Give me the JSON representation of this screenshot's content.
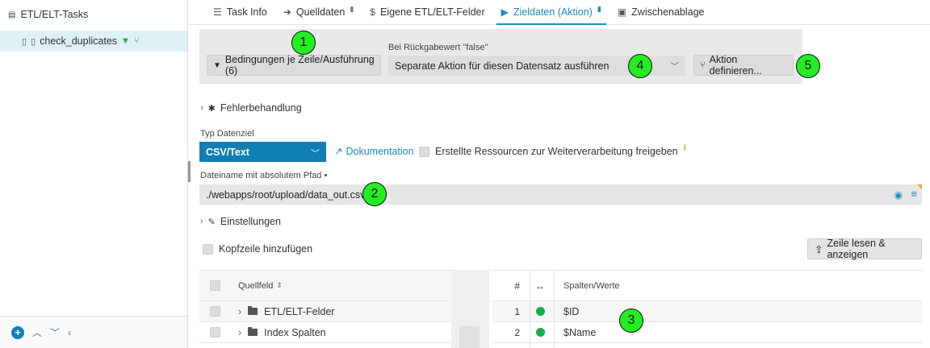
{
  "sidebar": {
    "title": "ETL/ELT-Tasks",
    "selected_item": "check_duplicates"
  },
  "tabs": [
    {
      "label": "Task Info",
      "icon": "list-icon"
    },
    {
      "label": "Quelldaten",
      "icon": "import-icon"
    },
    {
      "label": "Eigene ETL/ELT-Felder",
      "icon": "dollar-icon"
    },
    {
      "label": "Zieldaten (Aktion)",
      "icon": "play-icon",
      "active": true
    },
    {
      "label": "Zwischenablage",
      "icon": "clipboard-icon"
    }
  ],
  "conditions": {
    "button_label": "Bedingungen je Zeile/Ausführung (6)",
    "false_label": "Bei Rückgabewert \"false\"",
    "false_value": "Separate Aktion für diesen Datensatz ausführen",
    "define_action_label": "Aktion definieren..."
  },
  "sections": {
    "error_handling": "Fehlerbehandlung",
    "settings": "Einstellungen"
  },
  "target": {
    "type_label": "Typ Datenziel",
    "type_value": "CSV/Text",
    "doc_link": "Dokumentation",
    "release_checkbox": "Erstellte Ressourcen zur Weiterverarbeitung freigeben",
    "filename_label": "Dateiname mit absolutem Pfad •",
    "filename_value": "./webapps/root/upload/data_out.csv"
  },
  "header_checkbox": "Kopfzeile hinzufügen",
  "read_button": "Zeile lesen & anzeigen",
  "source_table": {
    "header": "Quellfeld",
    "rows": [
      "ETL/ELT-Felder",
      "Index Spalten"
    ]
  },
  "target_table": {
    "headers": {
      "num": "#",
      "arrow": "↔",
      "values": "Spalten/Werte"
    },
    "rows": [
      {
        "num": "1",
        "value": "$ID"
      },
      {
        "num": "2",
        "value": "$Name"
      }
    ]
  },
  "markers": [
    "1",
    "2",
    "3",
    "4",
    "5"
  ],
  "colors": {
    "accent": "#1c8ac0",
    "select_blue": "#0d7fb5",
    "marker_green": "#22ee22",
    "status_green": "#1aaa4a"
  }
}
